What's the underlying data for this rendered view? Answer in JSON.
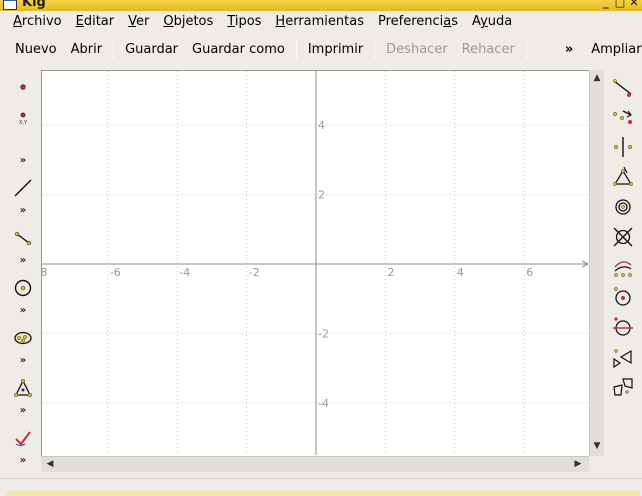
{
  "window": {
    "title": "Kig",
    "controls": [
      "_",
      "□",
      "✕"
    ]
  },
  "menubar": [
    {
      "pre": "",
      "key": "A",
      "post": "rchivo"
    },
    {
      "pre": "",
      "key": "E",
      "post": "ditar"
    },
    {
      "pre": "",
      "key": "V",
      "post": "er"
    },
    {
      "pre": "",
      "key": "O",
      "post": "bjetos"
    },
    {
      "pre": "",
      "key": "T",
      "post": "ipos"
    },
    {
      "pre": "",
      "key": "H",
      "post": "erramientas"
    },
    {
      "pre": "Preferenci",
      "key": "a",
      "post": "s"
    },
    {
      "pre": "A",
      "key": "y",
      "post": "uda"
    }
  ],
  "toolbar": {
    "new_label": "Nuevo",
    "open_label": "Abrir",
    "save_label": "Guardar",
    "save_as_label": "Guardar como",
    "print_label": "Imprimir",
    "undo_label": "Deshacer",
    "redo_label": "Rehacer",
    "more_label": "»",
    "zoom_label": "Ampliar",
    "grip_label": "⁝⁝"
  },
  "left_toolbar": {
    "tools": [
      "point-icon",
      "point-xy-icon",
      "line-icon",
      "segment-icon",
      "circle-icon",
      "conic-icon",
      "triangle-icon",
      "checkmark-icon"
    ],
    "xy_label": "X,Y",
    "more_glyph": "»"
  },
  "right_toolbar": {
    "tools": [
      "bisector-icon",
      "parallel-icon",
      "perpendicular-icon",
      "polygon-icon",
      "spiral-icon",
      "intersection-icon",
      "arc-icon",
      "circle-center-icon",
      "midline-circle-icon",
      "mirror-icon",
      "transform-icon"
    ]
  },
  "plot": {
    "x_ticks": [
      "8",
      "-6",
      "-4",
      "-2",
      "2",
      "4",
      "6"
    ],
    "y_ticks": [
      "4",
      "2",
      "-2",
      "-4"
    ],
    "axis_color": "#8c8c8c",
    "grid_color": "#c8c8c8",
    "label_color": "#9a9a9a"
  },
  "scrollbars": {
    "up": "▲",
    "down": "▼",
    "left": "◀",
    "right": "▶"
  },
  "statusbar": {
    "accent": "#f6e6a8"
  }
}
